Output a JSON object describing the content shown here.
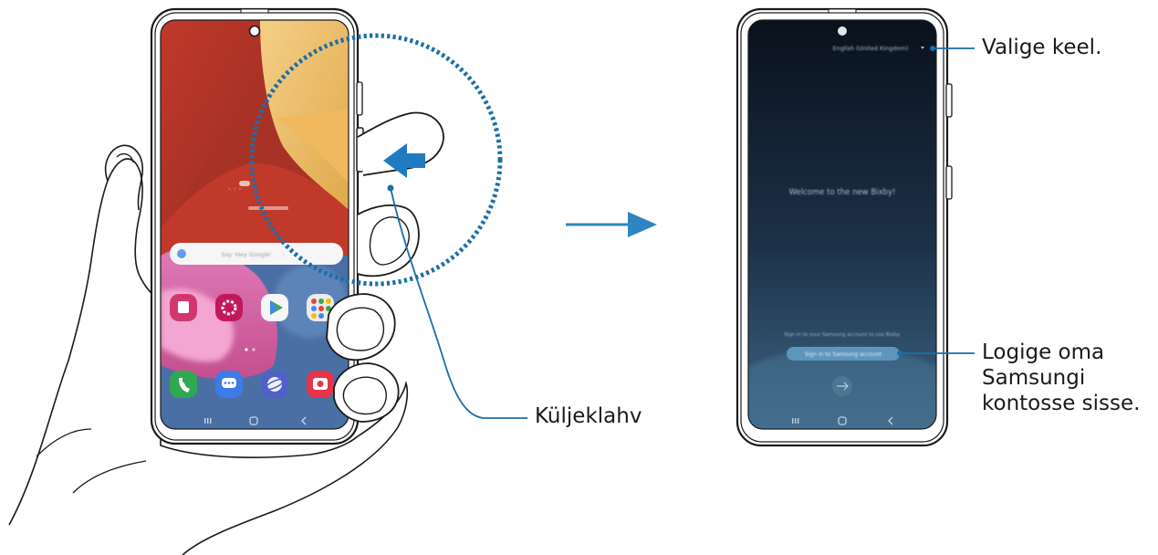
{
  "callouts": {
    "side_key": "Küljeklahv",
    "select_language": "Valige keel.",
    "sign_in": [
      "Logige oma",
      "Samsungi",
      "kontosse sisse."
    ]
  },
  "bixby_screen": {
    "language": "English (United Kingdom)",
    "welcome": "Welcome to the new Bixby!",
    "prompt": "Sign in to your Samsung account to use Bixby.",
    "button": "Sign in to Samsung account"
  },
  "home_screen": {
    "search_placeholder": "Say 'Hey Google'"
  },
  "colors": {
    "arrow": "#2e86c1",
    "leader_line": "#1a6fa8",
    "dotted_circle": "#1a6fa8",
    "bixby_bg_top": "#0b1320",
    "bixby_bg_bottom": "#3a5f7e"
  },
  "icons": [
    "hand-illustration",
    "side-key-press-arrow",
    "magnifier-circle",
    "flow-arrow",
    "navigation-bar"
  ]
}
